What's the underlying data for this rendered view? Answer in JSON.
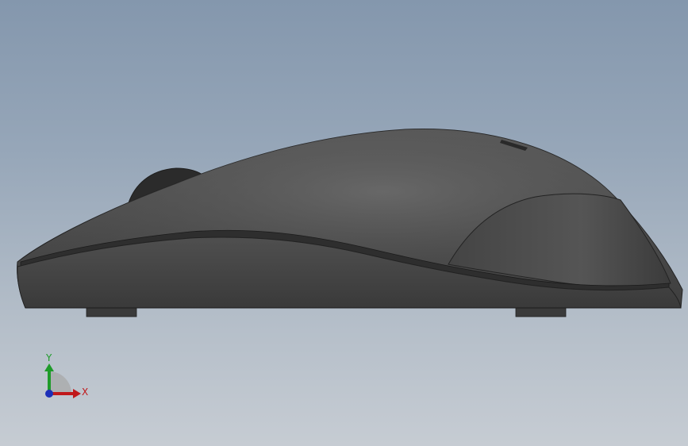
{
  "viewport": {
    "background_top": "#8497ad",
    "background_bottom": "#c6ccd3"
  },
  "model": {
    "body_color": "#4a4a4a",
    "accent_color": "#2f2f2f"
  },
  "triad": {
    "x_label": "X",
    "y_label": "Y",
    "x_color": "#c0181b",
    "y_color": "#1f9b2a",
    "z_color": "#1c2fb8"
  }
}
